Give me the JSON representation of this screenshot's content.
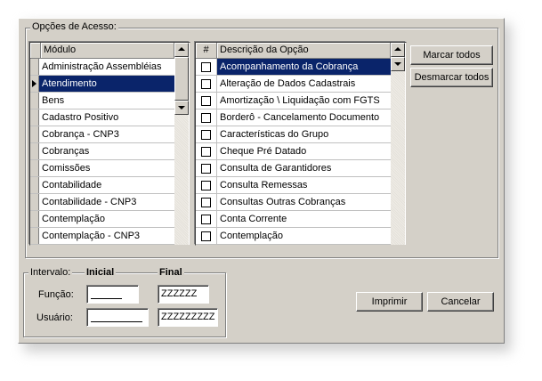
{
  "access_group": {
    "legend": "Opções de Acesso:",
    "module_grid": {
      "header": "Módulo",
      "selected_index": 1,
      "rows": [
        "Administração Assembléias",
        "Atendimento",
        "Bens",
        "Cadastro Positivo",
        "Cobrança - CNP3",
        "Cobranças",
        "Comissões",
        "Contabilidade",
        "Contabilidade - CNP3",
        "Contemplação",
        "Contemplação - CNP3"
      ]
    },
    "option_grid": {
      "headers": {
        "check": "#",
        "description": "Descrição da Opção"
      },
      "selected_index": 0,
      "rows": [
        {
          "label": "Acompanhamento da Cobrança",
          "checked": false
        },
        {
          "label": "Alteração de Dados Cadastrais",
          "checked": false
        },
        {
          "label": "Amortização \\ Liquidação com FGTS",
          "checked": false
        },
        {
          "label": "Borderô - Cancelamento Documento",
          "checked": false
        },
        {
          "label": "Características do Grupo",
          "checked": false
        },
        {
          "label": "Cheque Pré Datado",
          "checked": false
        },
        {
          "label": "Consulta de Garantidores",
          "checked": false
        },
        {
          "label": "Consulta Remessas",
          "checked": false
        },
        {
          "label": "Consultas Outras Cobranças",
          "checked": false
        },
        {
          "label": "Conta Corrente",
          "checked": false
        },
        {
          "label": "Contemplação",
          "checked": false
        }
      ]
    },
    "buttons": {
      "mark_all": "Marcar todos",
      "unmark_all": "Desmarcar todos"
    }
  },
  "interval_group": {
    "legend": "Intervalo:",
    "initial_label": "Inicial",
    "final_label": "Final",
    "function_label": "Função:",
    "user_label": "Usuário:",
    "function_initial": "",
    "function_final": "ZZZZZZ",
    "user_initial": "",
    "user_final": "ZZZZZZZZZ"
  },
  "actions": {
    "print": "Imprimir",
    "cancel": "Cancelar"
  },
  "colors": {
    "face": "#d4d0c8",
    "selection": "#0a246a",
    "window_bg": "#ffffff"
  }
}
